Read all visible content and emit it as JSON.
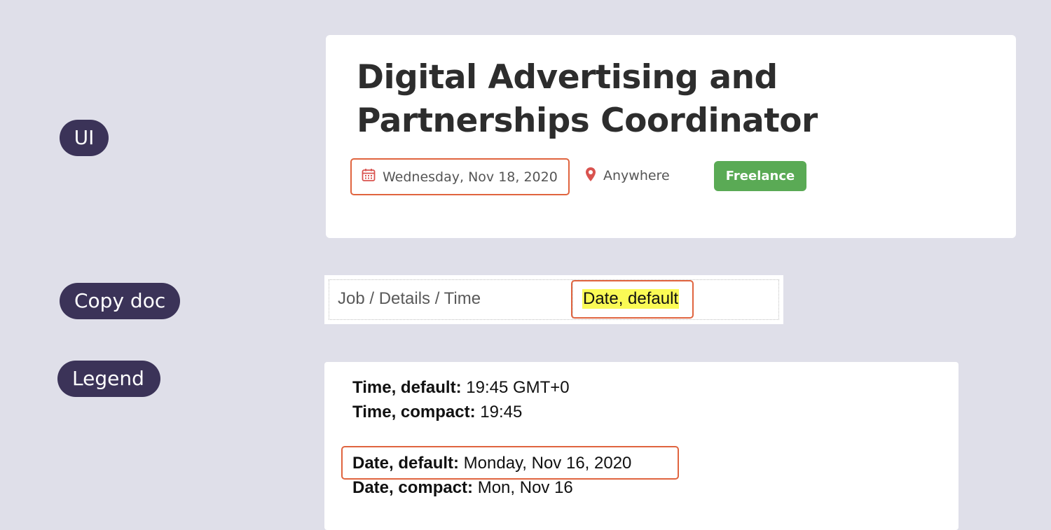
{
  "labels": {
    "ui": "UI",
    "copy_doc": "Copy doc",
    "legend": "Legend"
  },
  "job": {
    "title": "Digital Advertising and Partnerships Coordinator",
    "date": "Wednesday, Nov 18, 2020",
    "location": "Anywhere",
    "type_badge": "Freelance"
  },
  "copy_doc": {
    "path": "Job / Details / Time",
    "value": "Date, default"
  },
  "legend_lines": [
    {
      "key": "Time, default:",
      "value": " 19:45 GMT+0"
    },
    {
      "key": "Time, compact:",
      "value": " 19:45"
    },
    {
      "key": "Date, default:",
      "value": " Monday, Nov 16, 2020"
    },
    {
      "key": "Date, compact:",
      "value": " Mon, Nov 16"
    }
  ],
  "icons": {
    "date": "calendar-icon",
    "location": "map-pin-icon"
  },
  "colors": {
    "background": "#dfdfe9",
    "pill": "#3b3358",
    "accent_outline": "#e0643f",
    "badge": "#5aaa55",
    "highlight": "#fafa55"
  }
}
